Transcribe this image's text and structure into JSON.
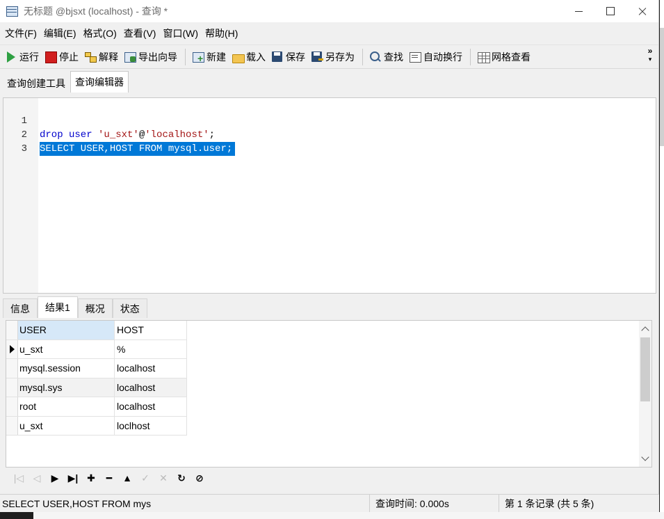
{
  "window": {
    "title": "无标题 @bjsxt (localhost) - 查询 *"
  },
  "menu": [
    "文件(F)",
    "编辑(E)",
    "格式(O)",
    "查看(V)",
    "窗口(W)",
    "帮助(H)"
  ],
  "toolbar": {
    "run": "运行",
    "stop": "停止",
    "explain": "解释",
    "export": "导出向导",
    "new": "新建",
    "load": "载入",
    "save": "保存",
    "saveas": "另存为",
    "find": "查找",
    "wrap": "自动换行",
    "grid": "网格查看",
    "more": "»"
  },
  "editor_tabs": [
    "查询创建工具",
    "查询编辑器"
  ],
  "editor": {
    "lines": [
      {
        "num": "1",
        "t1": "drop user ",
        "t2": "'u_sxt'",
        "t3": "@",
        "t4": "'localhost'",
        "t5": ";"
      },
      {
        "num": "2",
        "text": "SELECT USER,HOST FROM mysql.user;"
      },
      {
        "num": "3"
      }
    ]
  },
  "result_tabs": [
    "信息",
    "结果1",
    "概况",
    "状态"
  ],
  "grid": {
    "columns": [
      "USER",
      "HOST"
    ],
    "rows": [
      [
        "u_sxt",
        "%"
      ],
      [
        "mysql.session",
        "localhost"
      ],
      [
        "mysql.sys",
        "localhost"
      ],
      [
        "root",
        "localhost"
      ],
      [
        "u_sxt",
        "loclhost"
      ]
    ]
  },
  "nav": {
    "first": "|◁",
    "prev": "◁",
    "next": "▶",
    "last": "▶|",
    "add": "✚",
    "del": "━",
    "up": "▲",
    "apply": "✓",
    "cancel": "✕",
    "refresh": "↻",
    "stop": "⊘"
  },
  "status": {
    "sql": "SELECT USER,HOST FROM mys",
    "time": "查询时间: 0.000s",
    "record": "第 1 条记录 (共 5 条)"
  }
}
